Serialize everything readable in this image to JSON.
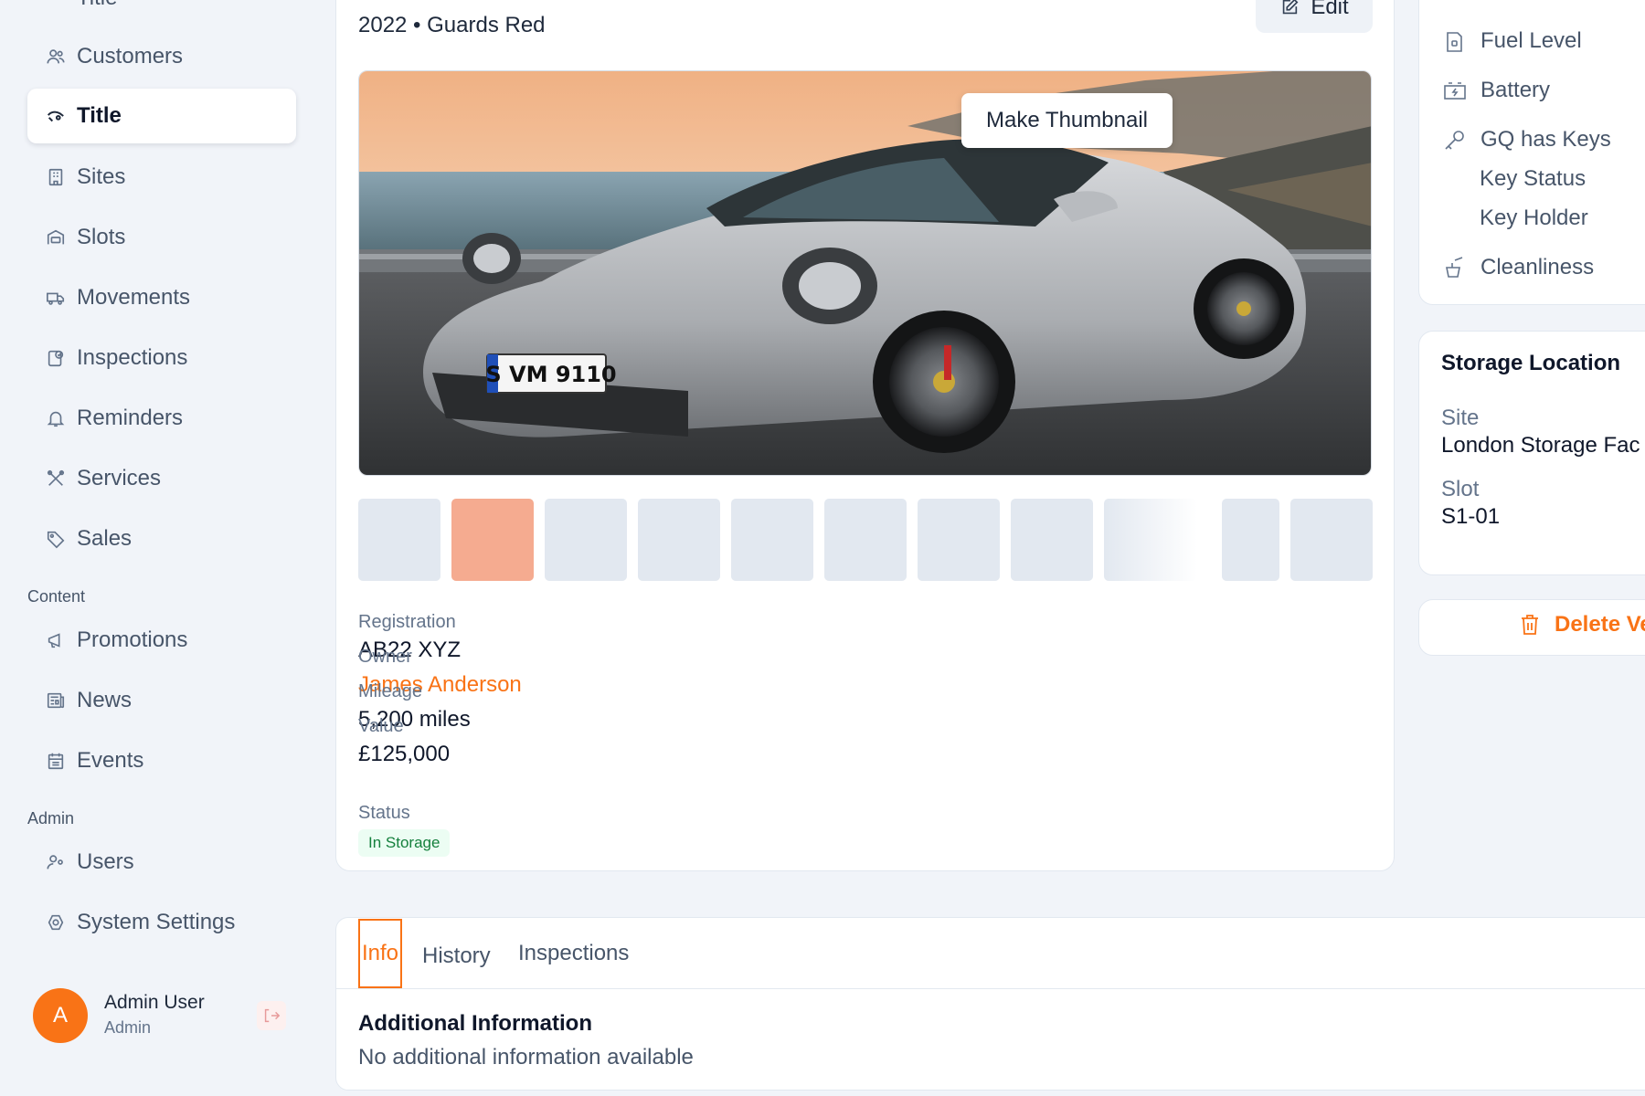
{
  "sidebar": {
    "items": [
      {
        "label": "Title",
        "icon": "car-icon"
      },
      {
        "label": "Customers",
        "icon": "users-icon"
      },
      {
        "label": "Title",
        "icon": "car-icon",
        "active": true
      },
      {
        "label": "Sites",
        "icon": "building-icon"
      },
      {
        "label": "Slots",
        "icon": "garage-icon"
      },
      {
        "label": "Movements",
        "icon": "truck-icon"
      },
      {
        "label": "Inspections",
        "icon": "clipboard-check-icon"
      },
      {
        "label": "Reminders",
        "icon": "bell-icon"
      },
      {
        "label": "Services",
        "icon": "tools-icon"
      },
      {
        "label": "Sales",
        "icon": "tag-icon"
      }
    ],
    "content_section_label": "Content",
    "content_items": [
      {
        "label": "Promotions",
        "icon": "megaphone-icon"
      },
      {
        "label": "News",
        "icon": "newspaper-icon"
      },
      {
        "label": "Events",
        "icon": "calendar-icon"
      }
    ],
    "admin_section_label": "Admin",
    "admin_items": [
      {
        "label": "Users",
        "icon": "user-cog-icon"
      },
      {
        "label": "System Settings",
        "icon": "settings-icon"
      }
    ],
    "user": {
      "initial": "A",
      "name": "Admin User",
      "role": "Admin"
    }
  },
  "vehicle": {
    "subtitle": "2022 • Guards Red",
    "edit_label": "Edit",
    "make_thumbnail_label": "Make Thumbnail",
    "plate_text": "S VM 9110",
    "fields": {
      "registration_label": "Registration",
      "registration_value": "AB22 XYZ",
      "owner_label": "Owner",
      "owner_value": "James Anderson",
      "mileage_label": "Mileage",
      "mileage_value": "5,200 miles",
      "value_label": "Value",
      "value_value": "£125,000",
      "status_label": "Status",
      "status_value": "In Storage"
    }
  },
  "tabs": [
    {
      "label": "Info",
      "active": true
    },
    {
      "label": "History"
    },
    {
      "label": "Inspections"
    }
  ],
  "info": {
    "title": "Additional Information",
    "text": "No additional information available"
  },
  "right_panel": {
    "status_items": [
      {
        "label": "Fuel Level",
        "icon": "fuel-icon"
      },
      {
        "label": "Battery",
        "icon": "battery-icon"
      },
      {
        "label": "GQ has Keys",
        "icon": "key-icon"
      }
    ],
    "key_status_label": "Key Status",
    "key_holder_label": "Key Holder",
    "cleanliness_label": "Cleanliness",
    "storage": {
      "title": "Storage Location",
      "site_label": "Site",
      "site_value": "London Storage Fac",
      "slot_label": "Slot",
      "slot_value": "S1-01"
    },
    "delete_label": "Delete Ve"
  },
  "colors": {
    "accent": "#f97316",
    "thumbnail_selected": "#f5ab90",
    "thumbnail_placeholder": "#e2e8f0",
    "badge_green_text": "#15803d",
    "badge_green_bg": "#ecfdf3"
  }
}
